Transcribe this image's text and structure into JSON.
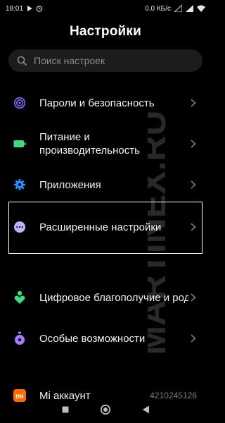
{
  "status_bar": {
    "time": "18:01",
    "left_icons": [
      "play-icon",
      "alarm-icon"
    ],
    "net_speed": "0,0 КБ/с",
    "right_icons": [
      "signal-icon",
      "signal-icon",
      "wifi-icon"
    ]
  },
  "header": {
    "title": "Настройки"
  },
  "search": {
    "placeholder": "Поиск настроек",
    "icon": "search-icon"
  },
  "items": [
    {
      "label": "Пароли и безопасность",
      "icon": "fingerprint-icon",
      "color": "#7b6cff"
    },
    {
      "label": "Питание и производительность",
      "icon": "battery-icon",
      "color": "#3ddc84"
    },
    {
      "label": "Приложения",
      "icon": "gear-icon",
      "color": "#2f8cff"
    },
    {
      "label": "Расширенные настройки",
      "icon": "more-dots-icon",
      "color": "#b9b6ff"
    },
    {
      "label": "Цифровое благополучие и родительский контро",
      "icon": "wellbeing-icon",
      "color": "#3ddc84"
    },
    {
      "label": "Особые возможности",
      "icon": "accessibility-icon",
      "color": "#a37bff"
    },
    {
      "label": "Mi аккаунт",
      "icon": "mi-icon",
      "color": "#ff6900",
      "value": "4210245126"
    }
  ],
  "watermark": "MARTINEX.RU",
  "navbar": {
    "buttons": [
      "square-button",
      "home-button",
      "back-button"
    ]
  },
  "colors": {
    "background": "#000000",
    "search_bg": "#1c1c1c",
    "text": "#f2f2f2",
    "chevron": "#7a7a7a"
  }
}
